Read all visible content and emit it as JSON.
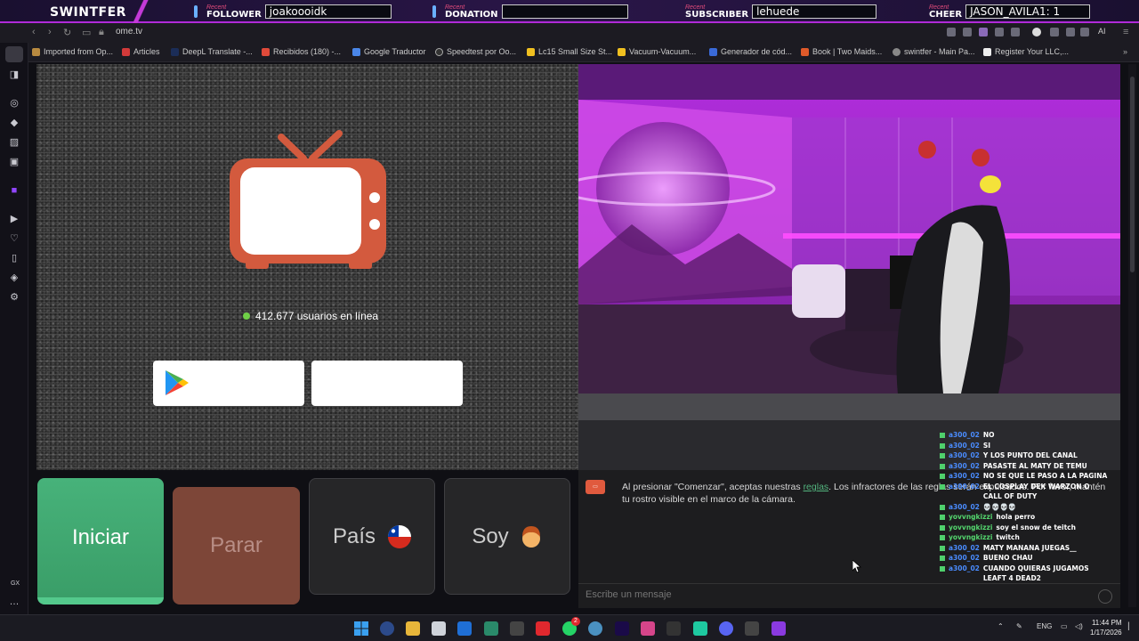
{
  "overlay": {
    "brand": "SWINTFER",
    "recent": "Recent",
    "follower": {
      "label": "FOLLOWER",
      "value": "joakoooidk"
    },
    "donation": {
      "label": "DONATION",
      "value": ""
    },
    "subscriber": {
      "label": "SUBSCRIBER",
      "value": "lehuede"
    },
    "cheer": {
      "label": "CHEER",
      "value": "JASON_AVILA1: 1"
    }
  },
  "browser": {
    "url": "ome.tv",
    "bookmarks": [
      "Imported from Op...",
      "Articles",
      "DeepL Translate -...",
      "Recibidos (180) -...",
      "Google Traductor",
      "Speedtest por Oo...",
      "Lc15 Small Size St...",
      "Vacuum-Vacuum...",
      "Generador de cód...",
      "Book | Two Maids...",
      "swintfer - Main Pa...",
      "Register Your LLC,..."
    ],
    "ai_label": "AI",
    "sidebar_gx": "GX"
  },
  "ome": {
    "online_text": "412.677 usuarios en línea",
    "buttons": {
      "start": "Iniciar",
      "stop": "Parar",
      "country": "País",
      "gender": "Soy"
    },
    "system_message": {
      "before": "Al presionar \"Comenzar\", aceptas nuestras ",
      "link": "reglas",
      "after": ". Los infractores de las reglas serán expulsados. Por favor, mantén tu rostro visible en el marco de la cámara."
    },
    "chat_placeholder": "Escribe un mensaje"
  },
  "twitch_chat": [
    {
      "user": "a300_02",
      "color": "#4a8cff",
      "msg": "NO"
    },
    {
      "user": "a300_02",
      "color": "#4a8cff",
      "msg": "SI"
    },
    {
      "user": "a300_02",
      "color": "#4a8cff",
      "msg": "Y LOS PUNTO DEL CANAL"
    },
    {
      "user": "a300_02",
      "color": "#4a8cff",
      "msg": "PASASTE AL MATY DE TEMU"
    },
    {
      "user": "a300_02",
      "color": "#4a8cff",
      "msg": "NO SE QUE LE PASO A LA PAGINA"
    },
    {
      "user": "a300_02",
      "color": "#4a8cff",
      "msg": "EL COSPLAY DEK WARZON O CALL OF DUTY"
    },
    {
      "user": "a300_02",
      "color": "#4a8cff",
      "msg": "💀💀💀💀"
    },
    {
      "user": "yovvngkizzi",
      "color": "#54d66e",
      "msg": "hola perro"
    },
    {
      "user": "yovvngkizzi",
      "color": "#54d66e",
      "msg": "soy el snow de teitch"
    },
    {
      "user": "yovvngkizzi",
      "color": "#54d66e",
      "msg": "twitch"
    },
    {
      "user": "a300_02",
      "color": "#4a8cff",
      "msg": "MATY MANANA JUEGAS__"
    },
    {
      "user": "a300_02",
      "color": "#4a8cff",
      "msg": "BUENO CHAU"
    },
    {
      "user": "a300_02",
      "color": "#4a8cff",
      "msg": "CUANDO QUIERAS JUGAMOS LEAFT 4 DEAD2"
    }
  ],
  "taskbar": {
    "lang": "ENG",
    "time": "11:44 PM",
    "date": "1/17/2026",
    "whatsapp_badge": "2"
  }
}
